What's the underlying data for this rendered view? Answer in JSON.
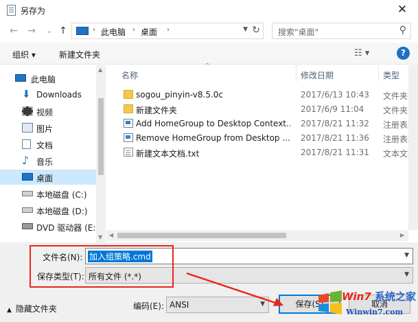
{
  "window": {
    "title": "另存为",
    "close_glyph": "✕"
  },
  "nav": {
    "back_glyph": "←",
    "forward_glyph": "→",
    "history_glyph": "⌄",
    "up_glyph": "↑",
    "breadcrumb": [
      "此电脑",
      "桌面"
    ],
    "breadcrumb_sep": "›",
    "search_placeholder": "搜索\"桌面\""
  },
  "toolbar": {
    "organize_label": "组织 ▾",
    "new_folder_label": "新建文件夹",
    "view_glyph": "☷ ▾",
    "help_label": "?"
  },
  "sidebar": {
    "items": [
      {
        "label": "此电脑",
        "icon": "pc-icon",
        "selected": false
      },
      {
        "label": "Downloads",
        "icon": "download-icon",
        "selected": false
      },
      {
        "label": "视频",
        "icon": "video-icon",
        "selected": false
      },
      {
        "label": "图片",
        "icon": "pictures-icon",
        "selected": false
      },
      {
        "label": "文档",
        "icon": "documents-icon",
        "selected": false
      },
      {
        "label": "音乐",
        "icon": "music-icon",
        "selected": false
      },
      {
        "label": "桌面",
        "icon": "desktop-icon",
        "selected": true
      },
      {
        "label": "本地磁盘 (C:)",
        "icon": "drive-icon",
        "selected": false
      },
      {
        "label": "本地磁盘 (D:)",
        "icon": "drive-icon",
        "selected": false
      },
      {
        "label": "DVD 驱动器 (E:)",
        "icon": "dvd-icon",
        "selected": false
      }
    ]
  },
  "file_list": {
    "columns": [
      "名称",
      "修改日期",
      "类型"
    ],
    "rows": [
      {
        "name": "sogou_pinyin-v8.5.0c",
        "date": "2017/6/13 10:43",
        "type": "文件夹",
        "icon": "folder-icon"
      },
      {
        "name": "新建文件夹",
        "date": "2017/6/9 11:04",
        "type": "文件夹",
        "icon": "folder-icon"
      },
      {
        "name": "Add HomeGroup to Desktop Context...",
        "date": "2017/8/21 11:32",
        "type": "注册表项",
        "icon": "registry-file-icon"
      },
      {
        "name": "Remove HomeGroup from Desktop ...",
        "date": "2017/8/21 11:36",
        "type": "注册表项",
        "icon": "registry-file-icon"
      },
      {
        "name": "新建文本文档.txt",
        "date": "2017/8/21 11:31",
        "type": "文本文档",
        "icon": "text-file-icon"
      }
    ]
  },
  "save_form": {
    "filename_label": "文件名(N):",
    "filename_value": "加入组策略.cmd",
    "filetype_label": "保存类型(T):",
    "filetype_value": "所有文件 (*.*)",
    "hide_folders_label": "隐藏文件夹",
    "encoding_label": "编码(E):",
    "encoding_value": "ANSI",
    "save_label": "保存(S)",
    "cancel_label": "取消"
  },
  "watermark": {
    "brand": "系统之家",
    "logo_text": "Win7",
    "site": "Winwin7.com"
  },
  "colors": {
    "accent": "#0078d7",
    "selection": "#cce8ff",
    "annotation_red": "#e8261a",
    "folder": "#f3c84d"
  }
}
